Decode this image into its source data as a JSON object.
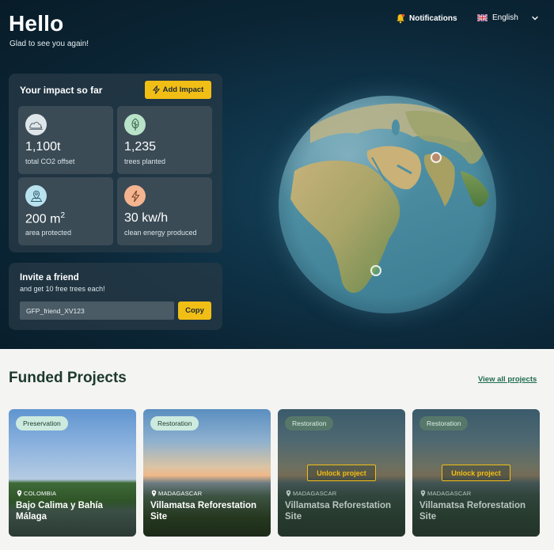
{
  "header": {
    "greeting": "Hello",
    "subtitle": "Glad to see you again!",
    "notifications_label": "Notifications",
    "language_label": "English"
  },
  "impact": {
    "title": "Your impact so far",
    "add_button_label": "Add Impact",
    "stats": [
      {
        "value": "1,100t",
        "label": "total CO2 offset",
        "icon": "cloud-icon",
        "icon_bg": "#dfe6ea"
      },
      {
        "value": "1,235",
        "label": "trees planted",
        "icon": "tree-icon",
        "icon_bg": "#b8e3c9"
      },
      {
        "value": "200 m",
        "value_sup": "2",
        "label": "area protected",
        "icon": "map-pin-icon",
        "icon_bg": "#b9e2ef"
      },
      {
        "value": "30 kw/h",
        "label": "clean energy produced",
        "icon": "lightning-icon",
        "icon_bg": "#f4b48f"
      }
    ]
  },
  "invite": {
    "title": "Invite a friend",
    "subtitle": "and get 10 free trees each!",
    "code": "GFP_friend_XV123",
    "copy_label": "Copy"
  },
  "projects": {
    "title": "Funded Projects",
    "view_all_label": "View all projects",
    "cards": [
      {
        "badge": "Preservation",
        "location": "COLOMBIA",
        "name": "Bajo Calima y Bahía Málaga",
        "locked": false
      },
      {
        "badge": "Restoration",
        "location": "MADAGASCAR",
        "name": "Villamatsa Reforestation Site",
        "locked": false
      },
      {
        "badge": "Restoration",
        "location": "MADAGASCAR",
        "name": "Villamatsa Reforestation Site",
        "locked": true,
        "unlock_label": "Unlock project"
      },
      {
        "badge": "Restoration",
        "location": "MADAGASCAR",
        "name": "Villamatsa Reforestation Site",
        "locked": true,
        "unlock_label": "Unlock project"
      }
    ]
  },
  "colors": {
    "accent": "#f1be16",
    "hero_bg": "#0b2535",
    "heading_green": "#1d3a2c",
    "link_green": "#1f6b4c"
  }
}
